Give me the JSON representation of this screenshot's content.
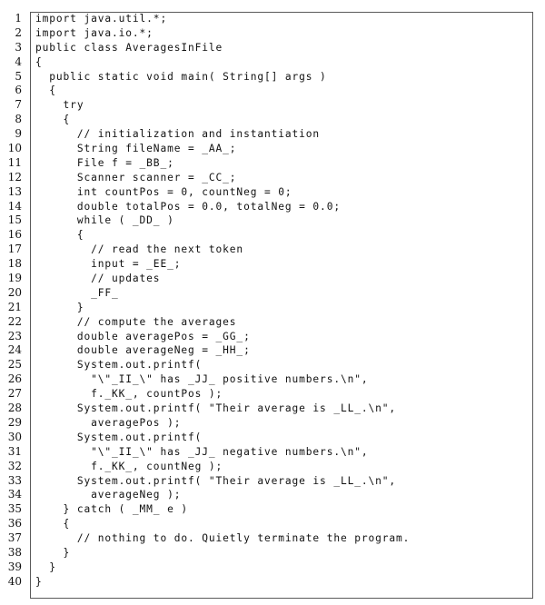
{
  "document": {
    "type": "code-listing",
    "language": "java",
    "lines": [
      {
        "n": "1",
        "text": "import java.util.*;"
      },
      {
        "n": "2",
        "text": "import java.io.*;"
      },
      {
        "n": "3",
        "text": "public class AveragesInFile"
      },
      {
        "n": "4",
        "text": "{"
      },
      {
        "n": "5",
        "text": "  public static void main( String[] args )"
      },
      {
        "n": "6",
        "text": "  {"
      },
      {
        "n": "7",
        "text": "    try"
      },
      {
        "n": "8",
        "text": "    {"
      },
      {
        "n": "9",
        "text": "      // initialization and instantiation"
      },
      {
        "n": "10",
        "text": "      String fileName = _AA_;"
      },
      {
        "n": "11",
        "text": "      File f = _BB_;"
      },
      {
        "n": "12",
        "text": "      Scanner scanner = _CC_;"
      },
      {
        "n": "13",
        "text": "      int countPos = 0, countNeg = 0;"
      },
      {
        "n": "14",
        "text": "      double totalPos = 0.0, totalNeg = 0.0;"
      },
      {
        "n": "15",
        "text": "      while ( _DD_ )"
      },
      {
        "n": "16",
        "text": "      {"
      },
      {
        "n": "17",
        "text": "        // read the next token"
      },
      {
        "n": "18",
        "text": "        input = _EE_;"
      },
      {
        "n": "19",
        "text": "        // updates"
      },
      {
        "n": "20",
        "text": "        _FF_"
      },
      {
        "n": "21",
        "text": "      }"
      },
      {
        "n": "22",
        "text": "      // compute the averages"
      },
      {
        "n": "23",
        "text": "      double averagePos = _GG_;"
      },
      {
        "n": "24",
        "text": "      double averageNeg = _HH_;"
      },
      {
        "n": "25",
        "text": "      System.out.printf("
      },
      {
        "n": "26",
        "text": "        \"\\\"_II_\\\" has _JJ_ positive numbers.\\n\","
      },
      {
        "n": "27",
        "text": "        f._KK_, countPos );"
      },
      {
        "n": "28",
        "text": "      System.out.printf( \"Their average is _LL_.\\n\","
      },
      {
        "n": "29",
        "text": "        averagePos );"
      },
      {
        "n": "30",
        "text": "      System.out.printf("
      },
      {
        "n": "31",
        "text": "        \"\\\"_II_\\\" has _JJ_ negative numbers.\\n\","
      },
      {
        "n": "32",
        "text": "        f._KK_, countNeg );"
      },
      {
        "n": "33",
        "text": "      System.out.printf( \"Their average is _LL_.\\n\","
      },
      {
        "n": "34",
        "text": "        averageNeg );"
      },
      {
        "n": "35",
        "text": "    } catch ( _MM_ e )"
      },
      {
        "n": "36",
        "text": "    {"
      },
      {
        "n": "37",
        "text": "      // nothing to do. Quietly terminate the program."
      },
      {
        "n": "38",
        "text": "    }"
      },
      {
        "n": "39",
        "text": "  }"
      },
      {
        "n": "40",
        "text": "}"
      }
    ]
  }
}
